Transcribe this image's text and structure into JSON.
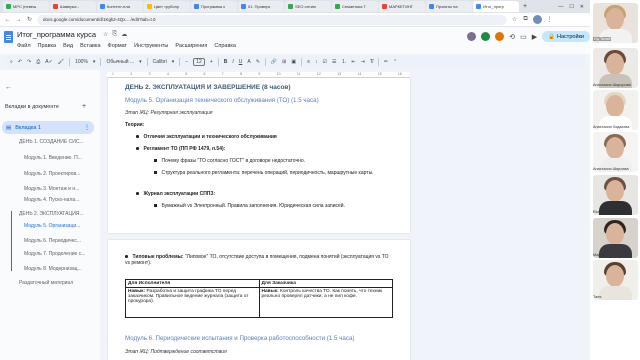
{
  "browser": {
    "tabs": [
      {
        "label": "МРС (невеш",
        "color": "#34a853",
        "active": false
      },
      {
        "label": "Шаверка -",
        "color": "#ea4335",
        "active": false
      },
      {
        "label": "Контент-пла",
        "color": "#4285f4",
        "active": false
      },
      {
        "label": "Цвет трубопр",
        "color": "#fbbc04",
        "active": false
      },
      {
        "label": "Программа о",
        "color": "#4285f4",
        "active": false
      },
      {
        "label": "01. Проверк",
        "color": "#4285f4",
        "active": false
      },
      {
        "label": "SEO оптим",
        "color": "#34a853",
        "active": false
      },
      {
        "label": "Семантика Т",
        "color": "#34a853",
        "active": false
      },
      {
        "label": "МАРКЕТИНГ",
        "color": "#ea4335",
        "active": false
      },
      {
        "label": "Проекты на",
        "color": "#4285f4",
        "active": false
      },
      {
        "label": "Итог_прогр",
        "color": "#4285f4",
        "active": true
      }
    ],
    "new_tab": "+",
    "url": "docs.google.com/document/d/1Kgk2-4Qx... /edit?tab=t.0"
  },
  "docs": {
    "title": "Итог_программа курса",
    "menu": [
      "Файл",
      "Правка",
      "Вид",
      "Вставка",
      "Формат",
      "Инструменты",
      "Расширения",
      "Справка"
    ],
    "share": "Настройки",
    "toolbar": {
      "zoom": "100%",
      "style": "Обычный ...",
      "font": "Calibri",
      "font_size": "12"
    }
  },
  "ruler": [
    "1",
    "2",
    "3",
    "4",
    "5",
    "6",
    "7",
    "8",
    "9",
    "10",
    "11",
    "12",
    "13",
    "14",
    "15",
    "16"
  ],
  "outline": {
    "header": "Вкладки в документе",
    "tab_name": "Вкладка 1",
    "items": [
      {
        "label": "ДЕНЬ 1. СОЗДАНИЕ СИС...",
        "selected": false
      },
      {
        "label": "Модуль 1. Введение. П...",
        "selected": false
      },
      {
        "label": "Модуль 2. Проектиров...",
        "selected": false
      },
      {
        "label": "Модуль 3. Монтаж и н...",
        "selected": false
      },
      {
        "label": "Модуль 4. Пуско-нала...",
        "selected": false
      },
      {
        "label": "ДЕНЬ 2. ЭКСПЛУАТАЦИЯ...",
        "selected": false
      },
      {
        "label": "Модуль 5. Организаци...",
        "selected": true
      },
      {
        "label": "Модуль 6. Периодичес...",
        "selected": false
      },
      {
        "label": "Модуль 7. Проделение с...",
        "selected": false
      },
      {
        "label": "Модуль 8. Модернизац...",
        "selected": false
      },
      {
        "label": "Раздаточный материал",
        "selected": false
      }
    ]
  },
  "page1": {
    "day_heading": "ДЕНЬ 2. ЭКСПЛУАТАЦИЯ И ЗАВЕРШЕНИЕ (8 часов)",
    "module_heading": "Модуль 5. Организация технического обслуживания (ТО) (1.5 часа)",
    "stage": "Этап ЖЦ: Регулярная эксплуатация",
    "theory": "Теория:",
    "b1": "Отличия эксплуатации и технического обслуживания",
    "b2": "Регламент ТО (ПП РФ 1479, п.54):",
    "b2_1": "Почему фразы \"ТО согласно ГОСТ\" в договоре недостаточно.",
    "b2_2": "Структура реального регламента: перечень операций, периодичность, маршрутные карты.",
    "b3": "Журнал эксплуатации СППЗ:",
    "b3_1": "Бумажный vs Электронный. Правила заполнения. Юридическая сила записей."
  },
  "page2": {
    "typical_bold": "Типовые проблемы:",
    "typical_rest": " \"Липовое\" ТО, отсутствие доступа в помещения, подмена понятий (эксплуатация vs ТО vs ремонт).",
    "table": {
      "h_left": "Для Исполнителя",
      "h_right": "Для Заказчика",
      "c_left_bold": "Навык:",
      "c_left_rest": " Разработка и защита графика ТО перед заказчиком. Правильное ведение журнала (защита от прокурора).",
      "c_right_bold": "Навык:",
      "c_right_rest": " Контроль качества ТО. Как понять, что техник реально проверял датчики, а не пил кофе."
    },
    "module6_heading": "Модуль 6. Периодические испытания и Проверка работоспособности (1.5 часа)",
    "stage2": "Этап ЖЦ: Подтверждение соответствия"
  },
  "call": {
    "top_label": "Ид Тихий",
    "participants": [
      {
        "name": "Анастасия Шаророва",
        "hair": "#6b4a36",
        "shirt": "#c9c2b8",
        "bg": "#eceae6"
      },
      {
        "name": "Анастасия Ходакова",
        "hair": "#e3d6c0",
        "shirt": "#ffffff",
        "bg": "#f3f1ee"
      },
      {
        "name": "Анастасия Шароава",
        "hair": "#8a6a4e",
        "shirt": "#efefef",
        "bg": "#f5f4f2"
      },
      {
        "name": "Ekaterina Petrov",
        "hair": "#6e5240",
        "shirt": "#2f2f33",
        "bg": "#e8e6e3"
      },
      {
        "name": "Мария",
        "hair": "#2e2420",
        "shirt": "#3a3a40",
        "bg": "#d8d2cc"
      },
      {
        "name": "Таня",
        "hair": "#5a4032",
        "shirt": "#e9e4dc",
        "bg": "#f1efea"
      }
    ]
  }
}
